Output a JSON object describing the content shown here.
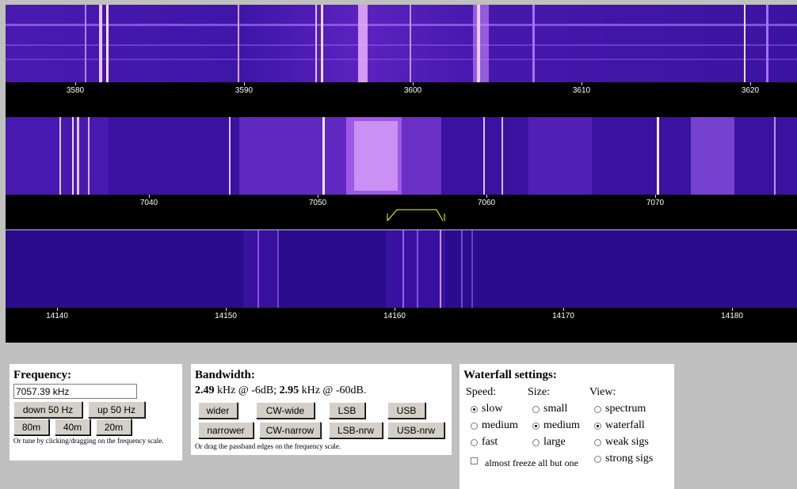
{
  "bands": [
    {
      "ticks": [
        "3580",
        "3590",
        "3600",
        "3610",
        "3620"
      ]
    },
    {
      "ticks": [
        "7040",
        "7050",
        "7060",
        "7070"
      ]
    },
    {
      "ticks": [
        "14140",
        "14150",
        "14160",
        "14170",
        "14180"
      ]
    }
  ],
  "frequency": {
    "title": "Frequency:",
    "value": "7057.39 kHz",
    "down_label": "down 50 Hz",
    "up_label": "up 50 Hz",
    "band_80": "80m",
    "band_40": "40m",
    "band_20": "20m",
    "note": "Or tune by clicking/dragging on the frequency scale."
  },
  "bandwidth": {
    "title": "Bandwidth:",
    "bw6": "2.49",
    "text6": " kHz @ -6dB; ",
    "bw60": "2.95",
    "text60": " kHz @ -60dB.",
    "wider": "wider",
    "narrower": "narrower",
    "cw_wide": "CW-wide",
    "cw_narrow": "CW-narrow",
    "lsb": "LSB",
    "lsb_nrw": "LSB-nrw",
    "usb": "USB",
    "usb_nrw": "USB-nrw",
    "note": "Or drag the passband edges on the frequency scale."
  },
  "waterfall": {
    "title": "Waterfall settings:",
    "speed_label": "Speed:",
    "size_label": "Size:",
    "view_label": "View:",
    "speed_slow": "slow",
    "speed_medium": "medium",
    "speed_fast": "fast",
    "size_small": "small",
    "size_medium": "medium",
    "size_large": "large",
    "view_spectrum": "spectrum",
    "view_waterfall": "waterfall",
    "view_weak": "weak sigs",
    "view_strong": "strong sigs",
    "freeze_label": "almost freeze all but one"
  },
  "colors": {
    "waterfall_bg": "#2a0c8c",
    "signal": "#b040ff",
    "passband": "#ffff00"
  }
}
